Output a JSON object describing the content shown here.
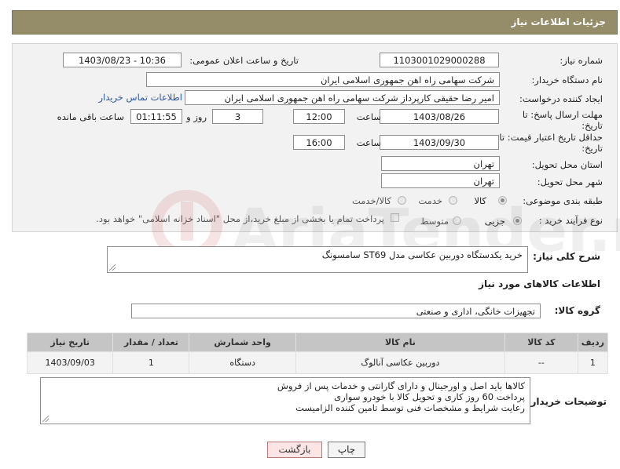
{
  "header": {
    "title": "جزئیات اطلاعات نیاز"
  },
  "form": {
    "need_number": {
      "label": "شماره نیاز:",
      "value": "1103001029000288"
    },
    "announce_date": {
      "label": "تاریخ و ساعت اعلان عمومی:",
      "value": "1403/08/23 - 10:36"
    },
    "buyer_org": {
      "label": "نام دستگاه خریدار:",
      "value": "شرکت سهامی راه اهن جمهوری اسلامی ایران"
    },
    "requester": {
      "label": "ایجاد کننده درخواست:",
      "value": "امیر رضا  حقیقی کارپرداز شرکت سهامی راه اهن جمهوری اسلامی ایران"
    },
    "contact_link": "اطلاعات تماس خریدار",
    "deadline": {
      "label": "مهلت ارسال پاسخ: تا تاریخ:",
      "date": "1403/08/26",
      "time_label": "ساعت",
      "time": "12:00",
      "days": "3",
      "days_label": "روز و",
      "remaining": "01:11:55",
      "remaining_label": "ساعت باقی مانده"
    },
    "price_validity": {
      "label": "حداقل تاریخ اعتبار قیمت: تا تاریخ:",
      "date": "1403/09/30",
      "time_label": "ساعت",
      "time": "16:00"
    },
    "province": {
      "label": "استان محل تحویل:",
      "value": "تهران"
    },
    "city": {
      "label": "شهر محل تحویل:",
      "value": "تهران"
    },
    "category": {
      "label": "طبقه بندی موضوعی:",
      "options": [
        "کالا",
        "خدمت",
        "کالا/خدمت"
      ],
      "selected": "کالا"
    },
    "purchase_process": {
      "label": "نوع فرآیند خرید :",
      "options": [
        "جزیی",
        "متوسط"
      ],
      "selected": "جزیی",
      "payment_note": "پرداخت تمام یا بخشی از مبلغ خرید،از محل \"اسناد خزانه اسلامی\" خواهد بود."
    }
  },
  "summary": {
    "label": "شرح کلی نیاز:",
    "value": "خرید یکدستگاه دوربین عکاسی مدل ST69 سامسونگ"
  },
  "goods_section": {
    "title": "اطلاعات کالاهای مورد نیاز"
  },
  "goods_group": {
    "label": "گروه کالا:",
    "value": "تجهیزات خانگی، اداری و صنعتی"
  },
  "table": {
    "headers": [
      "ردیف",
      "کد کالا",
      "نام کالا",
      "واحد شمارش",
      "تعداد / مقدار",
      "تاریخ نیاز"
    ],
    "rows": [
      [
        "1",
        "--",
        "دوربین عکاسی آنالوگ",
        "دستگاه",
        "1",
        "1403/09/03"
      ]
    ]
  },
  "buyer_notes": {
    "label": "توضیحات خریدار:",
    "lines": [
      "کالاها باید اصل و اورجینال و دارای گارانتی و خدمات پس از فروش",
      "پرداخت 60 روز کاری و تحویل کالا با خودرو سواری",
      "رعایت شرایط و مشخصات فنی توسط تامین کننده الزامیست"
    ]
  },
  "buttons": {
    "print": "چاپ",
    "back": "بازگشت"
  },
  "watermark": {
    "brand": "AriaTender.neT"
  }
}
